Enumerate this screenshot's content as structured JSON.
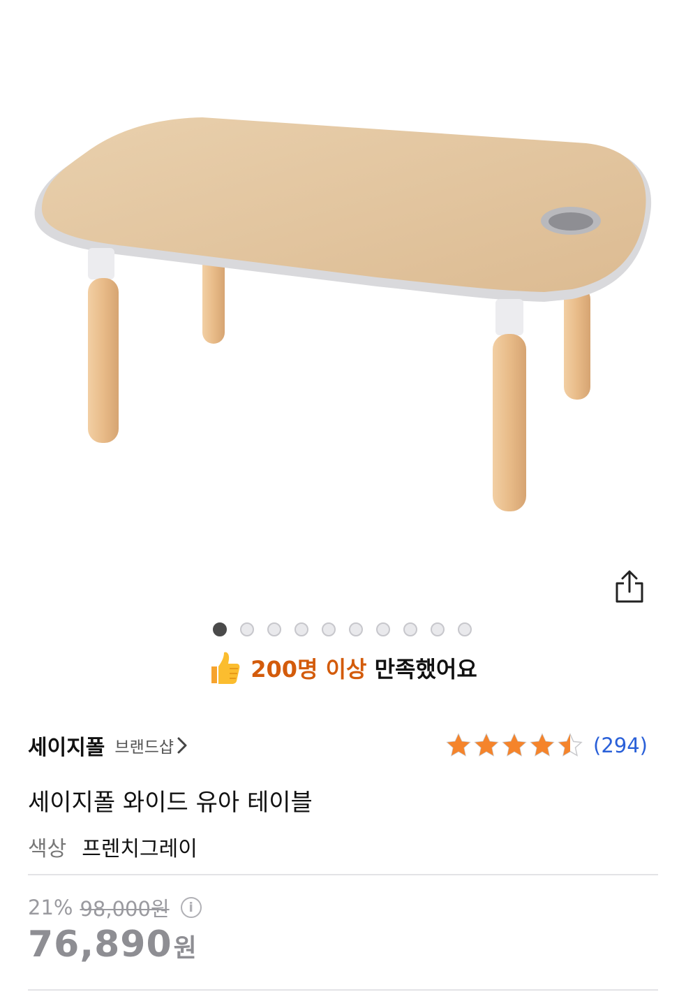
{
  "gallery": {
    "image_alt": "세이지폴 와이드 유아 테이블 product photo",
    "total_images": 10,
    "active_index": 0
  },
  "share": {
    "icon": "share-icon"
  },
  "satisfaction": {
    "highlight": "200명 이상",
    "rest": "만족했어요",
    "icon": "thumbs-up-icon"
  },
  "brand": {
    "name": "세이지폴",
    "shop_label": "브랜드샵",
    "chevron": "›"
  },
  "rating": {
    "stars": 4.5,
    "max_stars": 5,
    "star_color": "#f5842b",
    "review_count": "(294)"
  },
  "product": {
    "title": "세이지폴 와이드 유아 테이블",
    "option_label": "색상",
    "option_value": "프렌치그레이"
  },
  "price": {
    "discount": "21%",
    "original": "98,000원",
    "info_icon": "i",
    "final": "76,890",
    "currency": "원"
  }
}
